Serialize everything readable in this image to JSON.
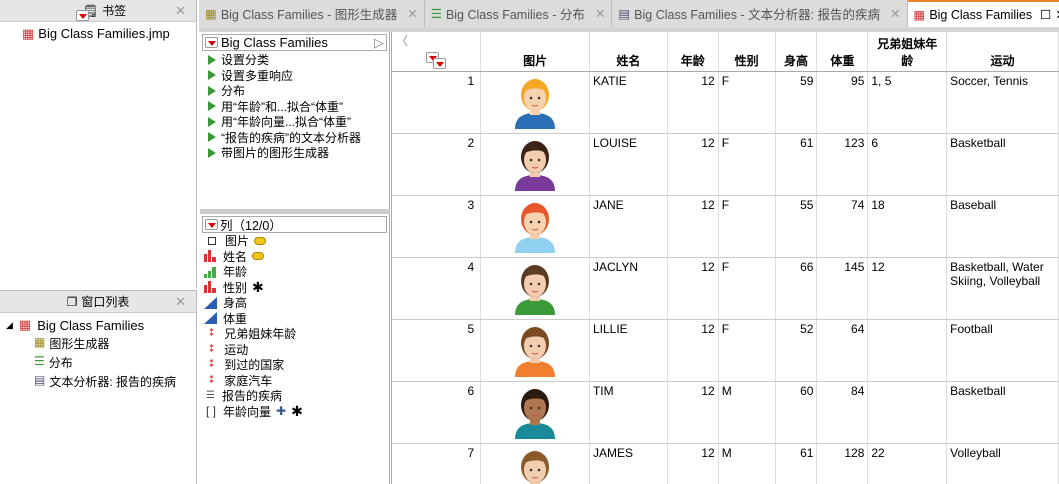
{
  "bookmarks": {
    "title": "书签",
    "items": [
      "Big Class Families.jmp"
    ]
  },
  "window_list": {
    "title": "窗口列表",
    "root": "Big Class Families",
    "items": [
      "图形生成器",
      "分布",
      "文本分析器: 报告的疾病"
    ]
  },
  "tabs": [
    {
      "label": "Big Class Families - 图形生成器"
    },
    {
      "label": "Big Class Families - 分布"
    },
    {
      "label": "Big Class Families - 文本分析器: 报告的疾病"
    },
    {
      "label": "Big Class Families",
      "active": true
    }
  ],
  "table_panel": {
    "title": "Big Class Families",
    "scripts": [
      "设置分类",
      "设置多重响应",
      "分布",
      "用“年龄”和...拟合“体重”",
      "用“年龄向量...拟合“体重”",
      "“报告的疾病”的文本分析器",
      "带图片的图形生成器"
    ]
  },
  "columns_panel": {
    "title": "列（12/0）",
    "columns": [
      {
        "name": "图片",
        "icon": "image-icon",
        "tag": true
      },
      {
        "name": "姓名",
        "icon": "nominal-icon",
        "tag": true
      },
      {
        "name": "年龄",
        "icon": "ordinal-icon"
      },
      {
        "name": "性别",
        "icon": "nominal-icon",
        "star": true
      },
      {
        "name": "身高",
        "icon": "continuous-icon"
      },
      {
        "name": "体重",
        "icon": "continuous-icon"
      },
      {
        "name": "兄弟姐妹年龄",
        "icon": "multiple-response-icon"
      },
      {
        "name": "运动",
        "icon": "multiple-response-icon"
      },
      {
        "name": "到过的国家",
        "icon": "multiple-response-icon"
      },
      {
        "name": "家庭汽车",
        "icon": "multiple-response-icon"
      },
      {
        "name": "报告的疾病",
        "icon": "unstructured-text-icon"
      },
      {
        "name": "年龄向量",
        "icon": "vector-icon",
        "plus": true,
        "star": true
      }
    ]
  },
  "grid": {
    "headers": [
      "图片",
      "姓名",
      "年龄",
      "性别",
      "身高",
      "体重",
      "兄弟姐妹年龄",
      "运动"
    ],
    "rows": [
      {
        "n": "1",
        "name": "KATIE",
        "age": "12",
        "sex": "F",
        "height": "59",
        "weight": "95",
        "sib": "1, 5",
        "sports": "Soccer, Tennis",
        "hair": "#f5a623",
        "skin": "#f7d2b0",
        "shirt": "#2a6fb5"
      },
      {
        "n": "2",
        "name": "LOUISE",
        "age": "12",
        "sex": "F",
        "height": "61",
        "weight": "123",
        "sib": "6",
        "sports": "Basketball",
        "hair": "#3b2417",
        "skin": "#f3cdb0",
        "shirt": "#7a3a9a"
      },
      {
        "n": "3",
        "name": "JANE",
        "age": "12",
        "sex": "F",
        "height": "55",
        "weight": "74",
        "sib": "18",
        "sports": "Baseball",
        "hair": "#e8572a",
        "skin": "#f7d2b0",
        "shirt": "#8fd0ef"
      },
      {
        "n": "4",
        "name": "JACLYN",
        "age": "12",
        "sex": "F",
        "height": "66",
        "weight": "145",
        "sib": "12",
        "sports": "Basketball, Water Skiing, Volleyball",
        "hair": "#5a3a22",
        "skin": "#f3cdb0",
        "shirt": "#3a9a3a"
      },
      {
        "n": "5",
        "name": "LILLIE",
        "age": "12",
        "sex": "F",
        "height": "52",
        "weight": "64",
        "sib": "",
        "sports": "Football",
        "hair": "#7a4a22",
        "skin": "#f3cdb0",
        "shirt": "#f08030"
      },
      {
        "n": "6",
        "name": "TIM",
        "age": "12",
        "sex": "M",
        "height": "60",
        "weight": "84",
        "sib": "",
        "sports": "Basketball",
        "hair": "#2a1a10",
        "skin": "#b07850",
        "shirt": "#1a8a9a"
      },
      {
        "n": "7",
        "name": "JAMES",
        "age": "12",
        "sex": "M",
        "height": "61",
        "weight": "128",
        "sib": "22",
        "sports": "Volleyball",
        "hair": "#8a5a2a",
        "skin": "#f3cdb0",
        "shirt": "#3a9a3a"
      }
    ]
  }
}
